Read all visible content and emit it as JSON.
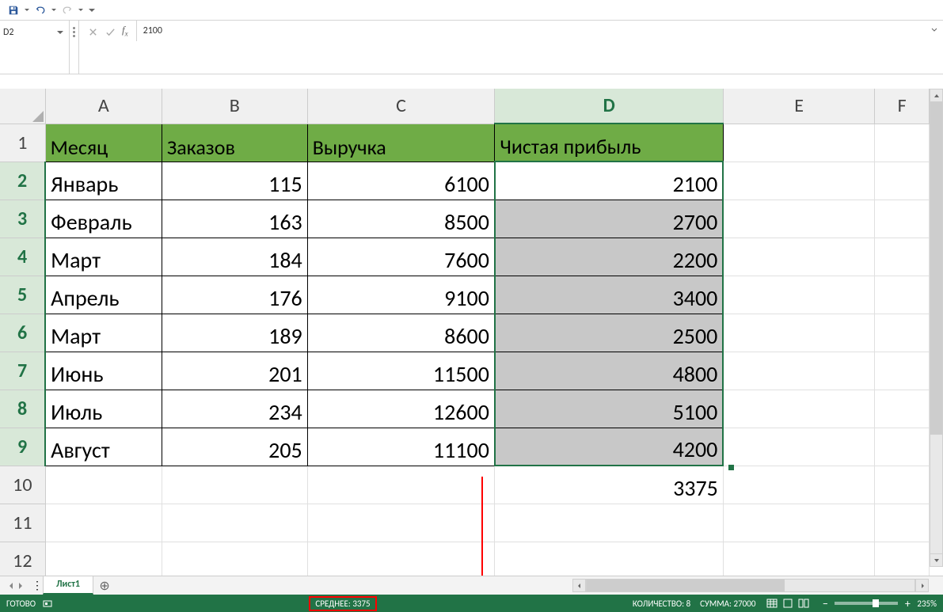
{
  "qat": {},
  "namebox": {
    "value": "D2"
  },
  "formula_bar": {
    "value": "2100"
  },
  "columns": [
    "A",
    "B",
    "C",
    "D",
    "E",
    "F"
  ],
  "rows": [
    1,
    2,
    3,
    4,
    5,
    6,
    7,
    8,
    9,
    10,
    11,
    12
  ],
  "selected_col": "D",
  "table": {
    "headers": {
      "A": "Месяц",
      "B": "Заказов",
      "C": "Выручка",
      "D": "Чистая прибыль"
    },
    "rows": [
      {
        "A": "Январь",
        "B": "115",
        "C": "6100",
        "D": "2100"
      },
      {
        "A": "Февраль",
        "B": "163",
        "C": "8500",
        "D": "2700"
      },
      {
        "A": "Март",
        "B": "184",
        "C": "7600",
        "D": "2200"
      },
      {
        "A": "Апрель",
        "B": "176",
        "C": "9100",
        "D": "3400"
      },
      {
        "A": "Март",
        "B": "189",
        "C": "8600",
        "D": "2500"
      },
      {
        "A": "Июнь",
        "B": "201",
        "C": "11500",
        "D": "4800"
      },
      {
        "A": "Июль",
        "B": "234",
        "C": "12600",
        "D": "5100"
      },
      {
        "A": "Август",
        "B": "205",
        "C": "11100",
        "D": "4200"
      }
    ]
  },
  "extra_cells": {
    "D10": "3375"
  },
  "sheet_tab": "Лист1",
  "statusbar": {
    "ready": "ГОТОВО",
    "average_label": "СРЕДНЕЕ:",
    "average_value": "3375",
    "count_label": "КОЛИЧЕСТВО:",
    "count_value": "8",
    "sum_label": "СУММА:",
    "sum_value": "27000",
    "zoom": "235%"
  }
}
